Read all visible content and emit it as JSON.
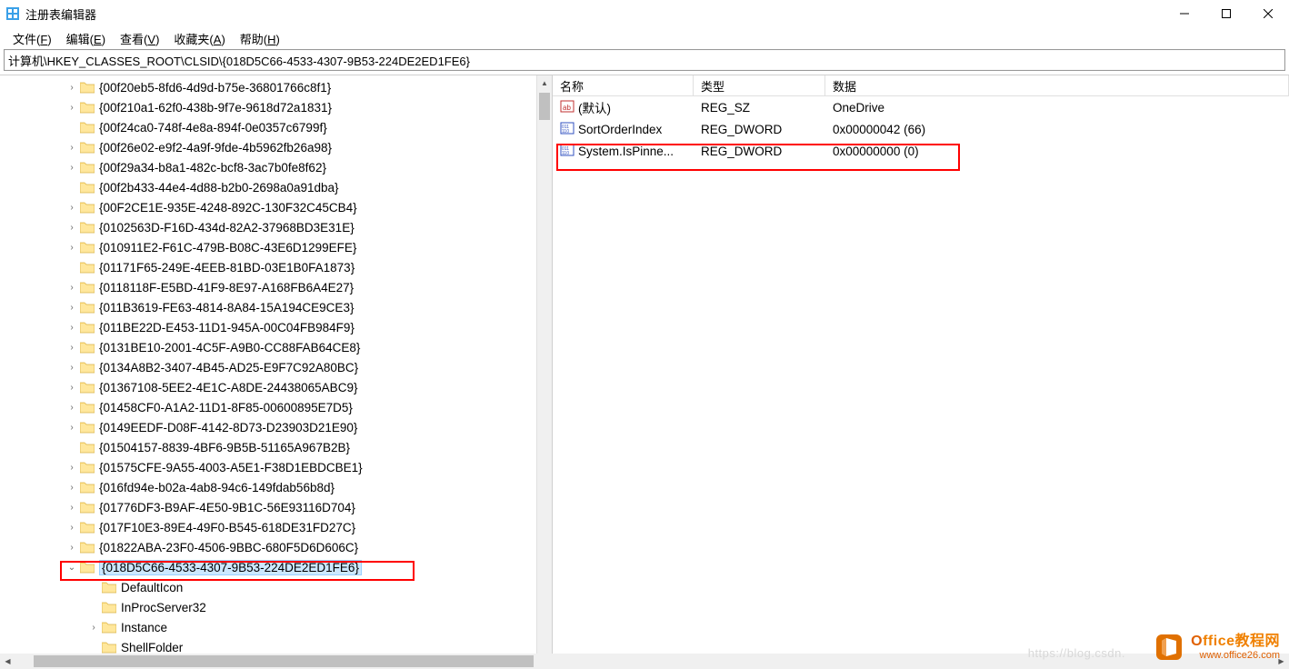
{
  "window": {
    "title": "注册表编辑器"
  },
  "menu": {
    "file": {
      "label": "文件",
      "accel": "F"
    },
    "edit": {
      "label": "编辑",
      "accel": "E"
    },
    "view": {
      "label": "查看",
      "accel": "V"
    },
    "fav": {
      "label": "收藏夹",
      "accel": "A"
    },
    "help": {
      "label": "帮助",
      "accel": "H"
    }
  },
  "path": "计算机\\HKEY_CLASSES_ROOT\\CLSID\\{018D5C66-4533-4307-9B53-224DE2ED1FE6}",
  "tree": {
    "items": [
      {
        "label": "{00f20eb5-8fd6-4d9d-b75e-36801766c8f1}",
        "expander": ">"
      },
      {
        "label": "{00f210a1-62f0-438b-9f7e-9618d72a1831}",
        "expander": ">"
      },
      {
        "label": "{00f24ca0-748f-4e8a-894f-0e0357c6799f}",
        "expander": ""
      },
      {
        "label": "{00f26e02-e9f2-4a9f-9fde-4b5962fb26a98}",
        "expander": ">"
      },
      {
        "label": "{00f29a34-b8a1-482c-bcf8-3ac7b0fe8f62}",
        "expander": ">"
      },
      {
        "label": "{00f2b433-44e4-4d88-b2b0-2698a0a91dba}",
        "expander": ""
      },
      {
        "label": "{00F2CE1E-935E-4248-892C-130F32C45CB4}",
        "expander": ">"
      },
      {
        "label": "{0102563D-F16D-434d-82A2-37968BD3E31E}",
        "expander": ">"
      },
      {
        "label": "{010911E2-F61C-479B-B08C-43E6D1299EFE}",
        "expander": ">"
      },
      {
        "label": "{01171F65-249E-4EEB-81BD-03E1B0FA1873}",
        "expander": ""
      },
      {
        "label": "{0118118F-E5BD-41F9-8E97-A168FB6A4E27}",
        "expander": ">"
      },
      {
        "label": "{011B3619-FE63-4814-8A84-15A194CE9CE3}",
        "expander": ">"
      },
      {
        "label": "{011BE22D-E453-11D1-945A-00C04FB984F9}",
        "expander": ">"
      },
      {
        "label": "{0131BE10-2001-4C5F-A9B0-CC88FAB64CE8}",
        "expander": ">"
      },
      {
        "label": "{0134A8B2-3407-4B45-AD25-E9F7C92A80BC}",
        "expander": ">"
      },
      {
        "label": "{01367108-5EE2-4E1C-A8DE-24438065ABC9}",
        "expander": ">"
      },
      {
        "label": "{01458CF0-A1A2-11D1-8F85-00600895E7D5}",
        "expander": ">"
      },
      {
        "label": "{0149EEDF-D08F-4142-8D73-D23903D21E90}",
        "expander": ">"
      },
      {
        "label": "{01504157-8839-4BF6-9B5B-51165A967B2B}",
        "expander": ""
      },
      {
        "label": "{01575CFE-9A55-4003-A5E1-F38D1EBDCBE1}",
        "expander": ">"
      },
      {
        "label": "{016fd94e-b02a-4ab8-94c6-149fdab56b8d}",
        "expander": ">"
      },
      {
        "label": "{01776DF3-B9AF-4E50-9B1C-56E93116D704}",
        "expander": ">"
      },
      {
        "label": "{017F10E3-89E4-49F0-B545-618DE31FD27C}",
        "expander": ">"
      },
      {
        "label": "{01822ABA-23F0-4506-9BBC-680F5D6D606C}",
        "expander": ">"
      },
      {
        "label": "{018D5C66-4533-4307-9B53-224DE2ED1FE6}",
        "expander": "v",
        "selected": true
      }
    ],
    "children": [
      {
        "label": "DefaultIcon",
        "expander": ""
      },
      {
        "label": "InProcServer32",
        "expander": ""
      },
      {
        "label": "Instance",
        "expander": ">"
      },
      {
        "label": "ShellFolder",
        "expander": ""
      }
    ]
  },
  "listHeader": {
    "name": "名称",
    "type": "类型",
    "data": "数据"
  },
  "values": [
    {
      "icon": "str",
      "name": "(默认)",
      "type": "REG_SZ",
      "data": "OneDrive"
    },
    {
      "icon": "bin",
      "name": "SortOrderIndex",
      "type": "REG_DWORD",
      "data": "0x00000042 (66)"
    },
    {
      "icon": "bin",
      "name": "System.IsPinne...",
      "type": "REG_DWORD",
      "data": "0x00000000 (0)"
    }
  ],
  "watermark": {
    "line1a": "O",
    "line1b": "ffice教程网",
    "line2": "www.office26.com"
  },
  "csdn": "https://blog.csdn."
}
